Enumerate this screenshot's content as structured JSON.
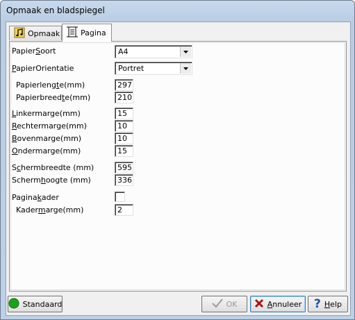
{
  "window": {
    "title": "Opmaak en bladspiegel"
  },
  "tabs": [
    {
      "label": "Opmaak",
      "icon": "music-note-icon"
    },
    {
      "label": "Pagina",
      "icon": "page-ruler-icon",
      "active": true
    }
  ],
  "form": {
    "papier_soort": {
      "label_pre": "Papier",
      "label_u": "S",
      "label_post": "oort",
      "value": "A4"
    },
    "papier_orientatie": {
      "label_pre": "",
      "label_u": "P",
      "label_post": "apierOrientatie",
      "value": "Portret"
    },
    "papier_lengte": {
      "label_pre": "Papierleng",
      "label_u": "t",
      "label_post": "e(mm)",
      "value": "297"
    },
    "papier_breedte": {
      "label_pre": "Papierbreed",
      "label_u": "t",
      "label_post": "e(mm)",
      "value": "210"
    },
    "linker_marge": {
      "label_pre": "",
      "label_u": "L",
      "label_post": "inkermarge(mm)",
      "value": "15"
    },
    "rechter_marge": {
      "label_pre": "",
      "label_u": "R",
      "label_post": "echtermarge(mm)",
      "value": "10"
    },
    "boven_marge": {
      "label_pre": "",
      "label_u": "B",
      "label_post": "ovenmarge(mm)",
      "value": "10"
    },
    "onder_marge": {
      "label_pre": "",
      "label_u": "O",
      "label_post": "ndermarge(mm)",
      "value": "15"
    },
    "scherm_breedte": {
      "label_pre": "S",
      "label_u": "c",
      "label_post": "hermbreedte (mm)",
      "value": "595"
    },
    "scherm_hoogte": {
      "label_pre": "Scherm",
      "label_u": "h",
      "label_post": "oogte (mm)",
      "value": "336"
    },
    "paginakader": {
      "label_pre": "Pagina",
      "label_u": "k",
      "label_post": "ader",
      "checked": false
    },
    "kader_marge": {
      "label_pre": "Kader",
      "label_u": "m",
      "label_post": "arge(mm)",
      "value": "2"
    }
  },
  "buttons": {
    "standaard": "Standaard",
    "ok": "OK",
    "annuleer_u": "A",
    "annuleer_rest": "nnuleer",
    "help_u": "H",
    "help_rest": "elp"
  },
  "colors": {
    "standaard_icon": "#1aa31a",
    "annuleer_icon": "#b01010",
    "help_icon": "#1f4fa8",
    "ok_disabled": "#9a9a9a"
  }
}
